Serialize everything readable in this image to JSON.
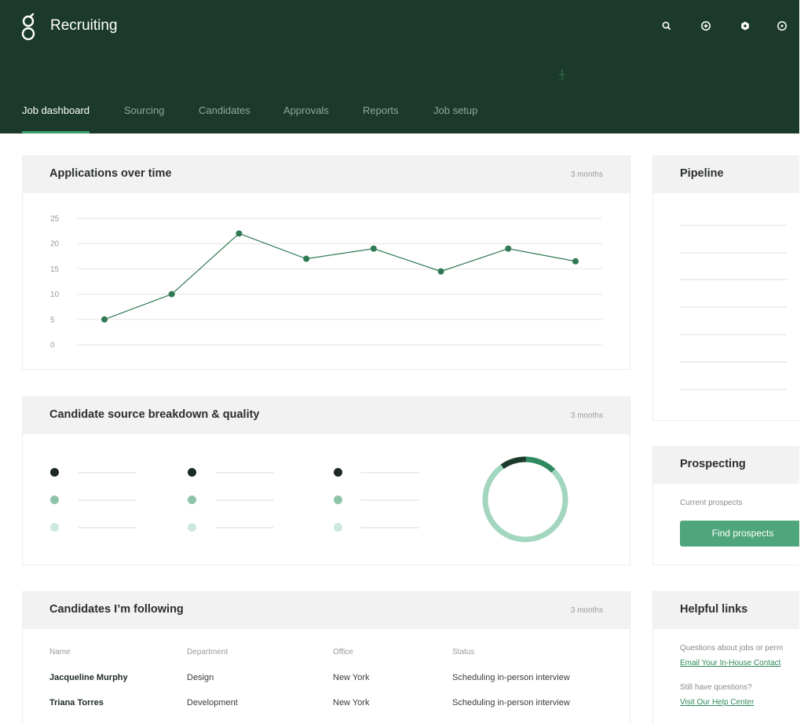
{
  "app": {
    "title": "Recruiting"
  },
  "header_icons": [
    "search-icon",
    "add-icon",
    "settings-icon",
    "help-icon"
  ],
  "nav": {
    "tabs": [
      {
        "label": "Job dashboard",
        "active": true
      },
      {
        "label": "Sourcing",
        "active": false
      },
      {
        "label": "Candidates",
        "active": false
      },
      {
        "label": "Approvals",
        "active": false
      },
      {
        "label": "Reports",
        "active": false
      },
      {
        "label": "Job setup",
        "active": false
      }
    ]
  },
  "applications": {
    "title": "Applications over time",
    "range": "3 months"
  },
  "chart_data": {
    "type": "line",
    "title": "Applications over time",
    "ylim": [
      0,
      25
    ],
    "y_ticks": [
      "25",
      "20",
      "15",
      "10",
      "5",
      "0"
    ],
    "grid": true,
    "series": [
      {
        "values": [
          5,
          10,
          22,
          17,
          19,
          14.5,
          19,
          16.5
        ]
      }
    ],
    "color": "#2f7a52"
  },
  "source_breakdown": {
    "title": "Candidate source breakdown & quality",
    "range": "3 months",
    "legend_colors": [
      "#1c2a22",
      "#8ec4a9",
      "#cde9db"
    ],
    "donut": {
      "dark_fraction": 0.1,
      "mid_fraction": 0.12,
      "light_fraction": 0.78
    }
  },
  "following": {
    "title": "Candidates I’m following",
    "range": "3 months",
    "columns": [
      "Name",
      "Department",
      "Office",
      "Status"
    ],
    "rows": [
      [
        "Jacqueline Murphy",
        "Design",
        "New York",
        "Scheduling in-person interview"
      ],
      [
        "Triana Torres",
        "Development",
        "New York",
        "Scheduling in-person interview"
      ]
    ]
  },
  "pipeline": {
    "title": "Pipeline"
  },
  "prospecting": {
    "title": "Prospecting",
    "current_label": "Current prospects",
    "button_label": "Find prospects"
  },
  "helpful_links": {
    "title": "Helpful links",
    "question_text": "Questions about jobs or perm",
    "link1": "Email Your In-House Contact",
    "still_text": "Still have questions?",
    "link2": "Visit Our Help Center"
  }
}
